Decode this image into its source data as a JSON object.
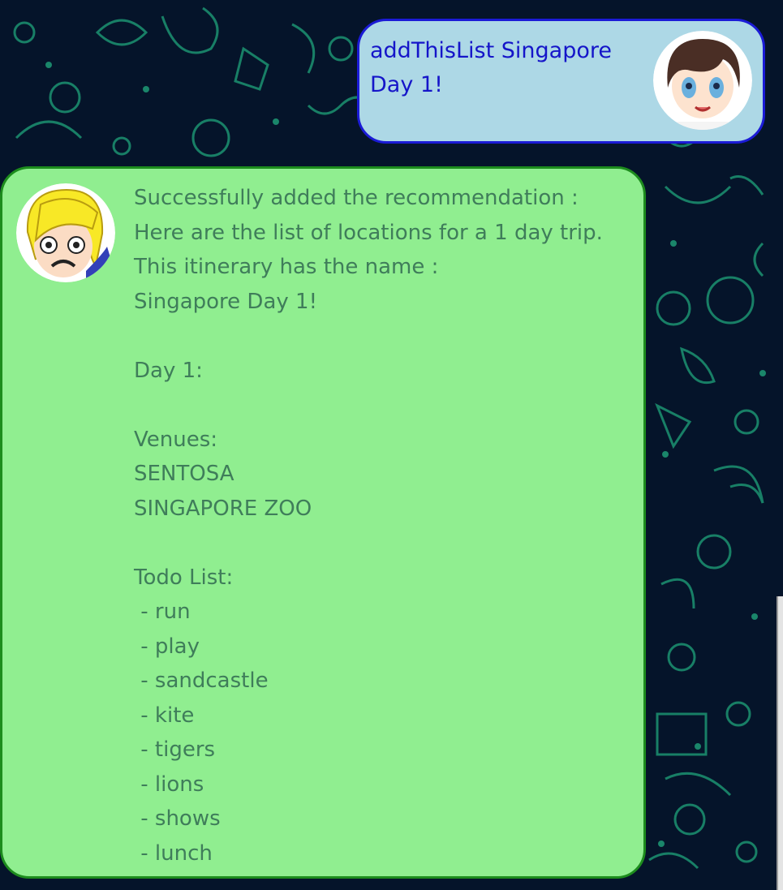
{
  "chat": {
    "user_message": "addThisList Singapore\nDay 1!",
    "bot_message": "Successfully added the recommendation :\nHere are the list of locations for a 1 day trip.\nThis itinerary has the name :\nSingapore Day 1!\n\nDay 1:\n\nVenues:\nSENTOSA\nSINGAPORE ZOO\n\nTodo List:\n - run\n - play\n - sandcastle\n - kite\n - tigers\n - lions\n - shows\n - lunch"
  },
  "colors": {
    "background": "#05142a",
    "doodle": "#1fa37a",
    "user_bubble": "#add8e6",
    "user_border": "#1b1bd6",
    "user_text": "#1515c9",
    "bot_bubble": "#90ee90",
    "bot_border": "#1d8c1d",
    "bot_text": "#3f7d5a"
  },
  "icons": {
    "user_avatar": "anime-boy-avatar",
    "bot_avatar": "cartoon-blond-character-avatar"
  }
}
